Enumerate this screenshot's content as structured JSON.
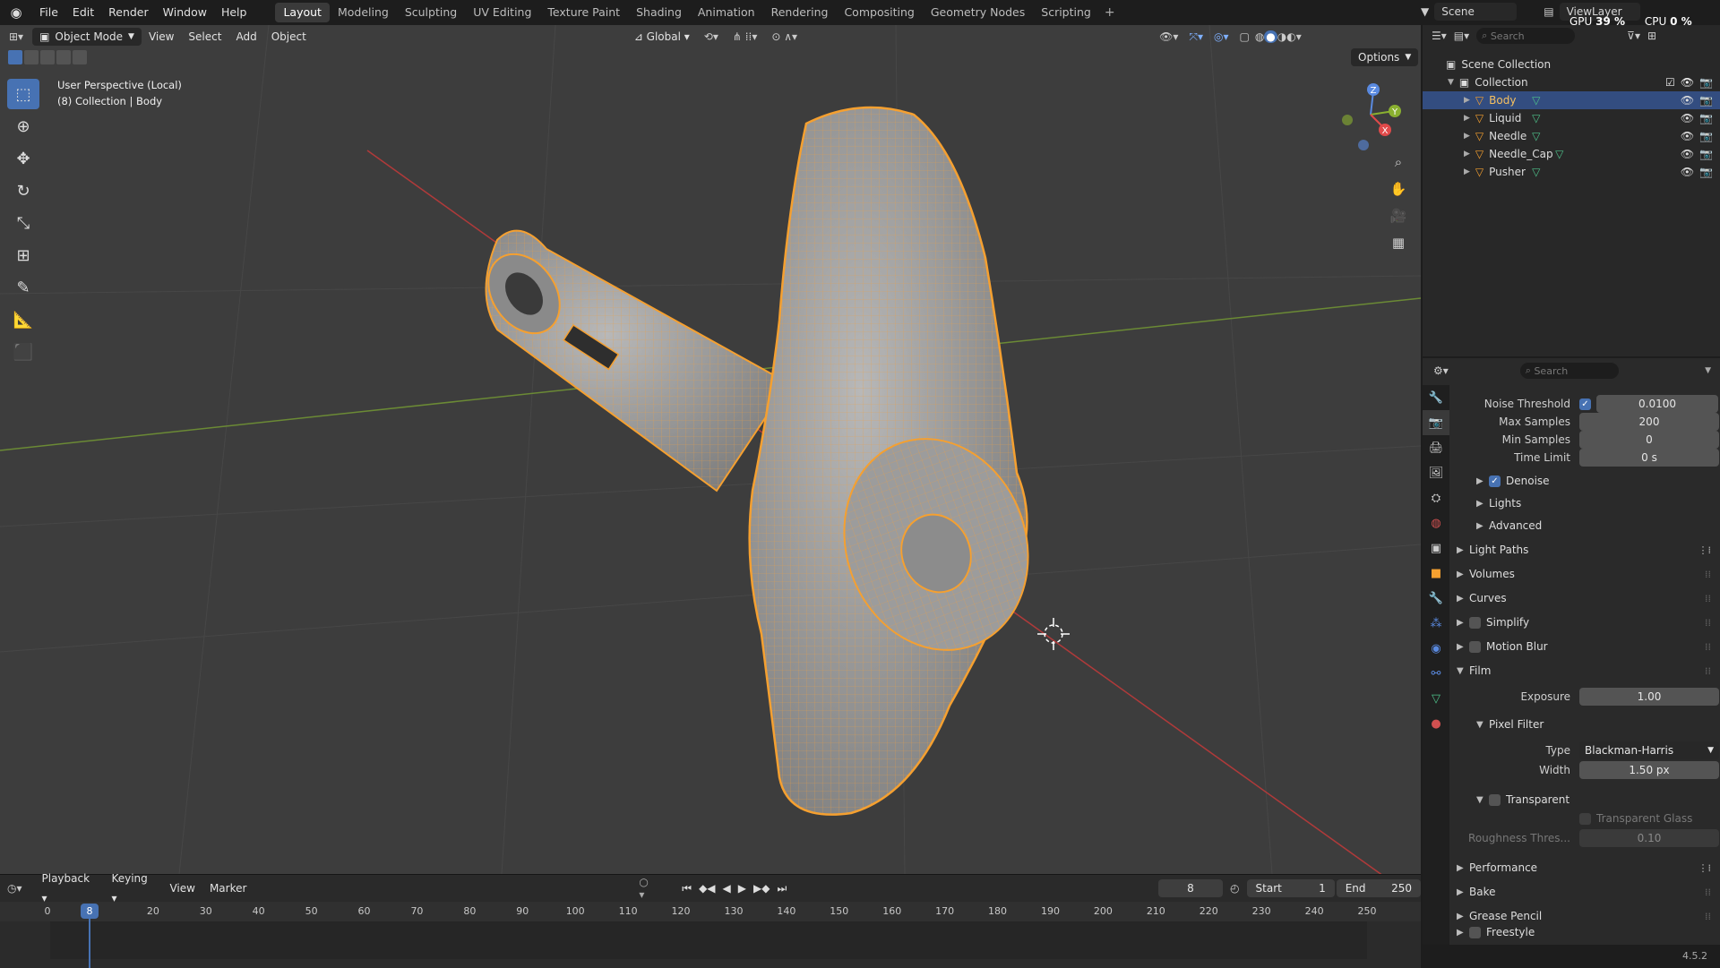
{
  "topbar": {
    "menu": [
      "File",
      "Edit",
      "Render",
      "Window",
      "Help"
    ],
    "workspaces": [
      "Layout",
      "Modeling",
      "Sculpting",
      "UV Editing",
      "Texture Paint",
      "Shading",
      "Animation",
      "Rendering",
      "Compositing",
      "Geometry Nodes",
      "Scripting"
    ],
    "active_workspace": "Layout",
    "scene": "Scene",
    "view_layer": "ViewLayer",
    "gpu_label": "GPU",
    "gpu_value": "39 %",
    "cpu_label": "CPU",
    "cpu_value": "0 %"
  },
  "viewport": {
    "mode": "Object Mode",
    "menus": [
      "View",
      "Select",
      "Add",
      "Object"
    ],
    "orientation": "Global",
    "options_label": "Options",
    "overlay_line1": "User Perspective (Local)",
    "overlay_line2": "(8) Collection | Body",
    "gizmo": {
      "z": "Z",
      "y": "Y",
      "x": "X"
    }
  },
  "timeline": {
    "menus": [
      "Playback",
      "Keying",
      "View",
      "Marker"
    ],
    "current_frame": "8",
    "start_label": "Start",
    "start_value": "1",
    "end_label": "End",
    "end_value": "250",
    "ticks": [
      "0",
      "20",
      "30",
      "40",
      "50",
      "60",
      "70",
      "80",
      "90",
      "100",
      "110",
      "120",
      "130",
      "140",
      "150",
      "160",
      "170",
      "180",
      "190",
      "200",
      "210",
      "220",
      "230",
      "240",
      "250"
    ],
    "playhead_label": "8"
  },
  "outliner": {
    "search_placeholder": "Search",
    "scene_collection": "Scene Collection",
    "collection": "Collection",
    "objects": [
      "Body",
      "Liquid",
      "Needle",
      "Needle_Cap",
      "Pusher"
    ],
    "selected": "Body"
  },
  "properties": {
    "search_placeholder": "Search",
    "noise_threshold_label": "Noise Threshold",
    "noise_threshold_value": "0.0100",
    "max_samples_label": "Max Samples",
    "max_samples_value": "200",
    "min_samples_label": "Min Samples",
    "min_samples_value": "0",
    "time_limit_label": "Time Limit",
    "time_limit_value": "0 s",
    "denoise_label": "Denoise",
    "lights_label": "Lights",
    "advanced_label": "Advanced",
    "light_paths_label": "Light Paths",
    "volumes_label": "Volumes",
    "curves_label": "Curves",
    "simplify_label": "Simplify",
    "motion_blur_label": "Motion Blur",
    "film_label": "Film",
    "exposure_label": "Exposure",
    "exposure_value": "1.00",
    "pixel_filter_label": "Pixel Filter",
    "type_label": "Type",
    "type_value": "Blackman-Harris",
    "width_label": "Width",
    "width_value": "1.50 px",
    "transparent_label": "Transparent",
    "transparent_glass_label": "Transparent Glass",
    "roughness_label": "Roughness Thres...",
    "roughness_value": "0.10",
    "performance_label": "Performance",
    "bake_label": "Bake",
    "grease_pencil_label": "Grease Pencil",
    "freestyle_label": "Freestyle"
  },
  "status": {
    "version": "4.5.2"
  },
  "colors": {
    "accent": "#4772b3",
    "selection": "#f5a030",
    "viewport_bg": "#3d3d3d",
    "panel_bg": "#2a2a2a"
  }
}
